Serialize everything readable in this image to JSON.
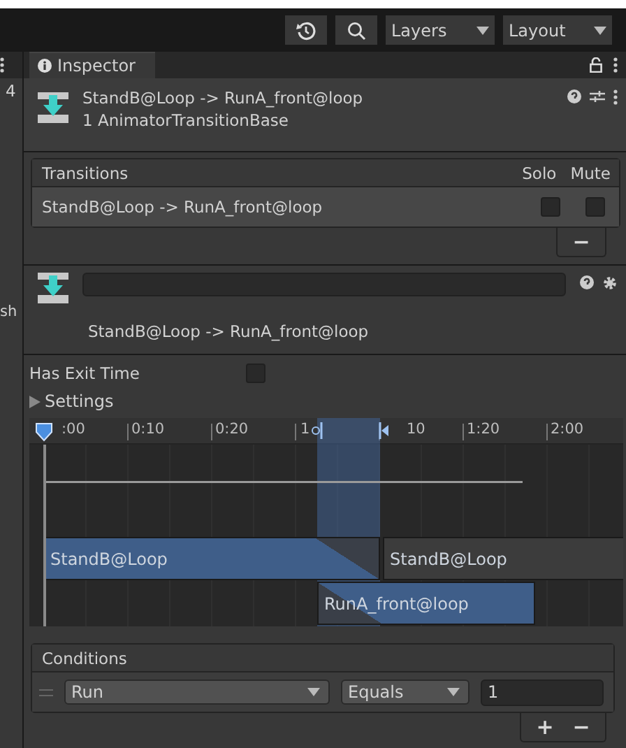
{
  "toolbar": {
    "dropdowns": [
      {
        "label": "Layers"
      },
      {
        "label": "Layout"
      }
    ]
  },
  "left_panel": {
    "texts": [
      "4",
      "sh"
    ]
  },
  "tab": {
    "label": "Inspector",
    "selected": true
  },
  "header": {
    "title": "StandB@Loop -> RunA_front@loop",
    "subtitle": "1 AnimatorTransitionBase"
  },
  "transitions": {
    "title": "Transitions",
    "columns": [
      "Solo",
      "Mute"
    ],
    "rows": [
      {
        "name": "StandB@Loop -> RunA_front@loop",
        "solo": false,
        "mute": false
      }
    ],
    "remove": "−"
  },
  "transition": {
    "label": "StandB@Loop -> RunA_front@loop",
    "has_exit_time_label": "Has Exit Time",
    "has_exit_time": false,
    "settings_label": "Settings",
    "settings_expanded": false
  },
  "timeline": {
    "ticks": [
      ":00",
      "0:10",
      "0:20",
      "1",
      "10",
      "1:20",
      "2:00"
    ],
    "clips": [
      {
        "label": "StandB@Loop",
        "kind": "source"
      },
      {
        "label": "StandB@Loop",
        "kind": "next"
      },
      {
        "label": "RunA_front@loop",
        "kind": "target"
      }
    ]
  },
  "conditions": {
    "title": "Conditions",
    "rows": [
      {
        "parameter": "Run",
        "mode": "Equals",
        "value": "1"
      }
    ],
    "add": "+",
    "remove": "−"
  }
}
